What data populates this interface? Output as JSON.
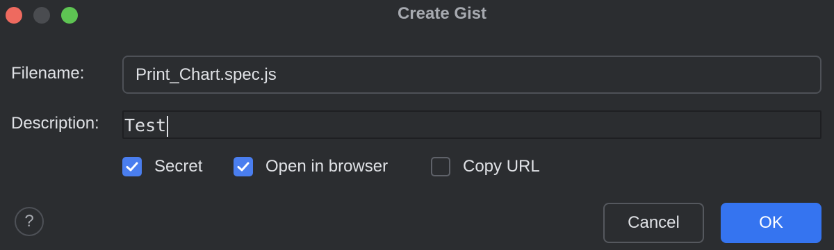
{
  "window": {
    "title": "Create Gist"
  },
  "form": {
    "filename_label": "Filename:",
    "filename_value": "Print_Chart.spec.js",
    "description_label": "Description:",
    "description_value": "Test"
  },
  "options": [
    {
      "label": "Secret",
      "checked": true
    },
    {
      "label": "Open in browser",
      "checked": true
    },
    {
      "label": "Copy URL",
      "checked": false
    }
  ],
  "footer": {
    "help_label": "?",
    "cancel_label": "Cancel",
    "ok_label": "OK"
  },
  "icons": {
    "check": "checkmark-icon",
    "help": "question-mark-icon"
  },
  "colors": {
    "accent": "#3574f0",
    "checkbox": "#4a7eef",
    "background": "#2b2d30"
  }
}
